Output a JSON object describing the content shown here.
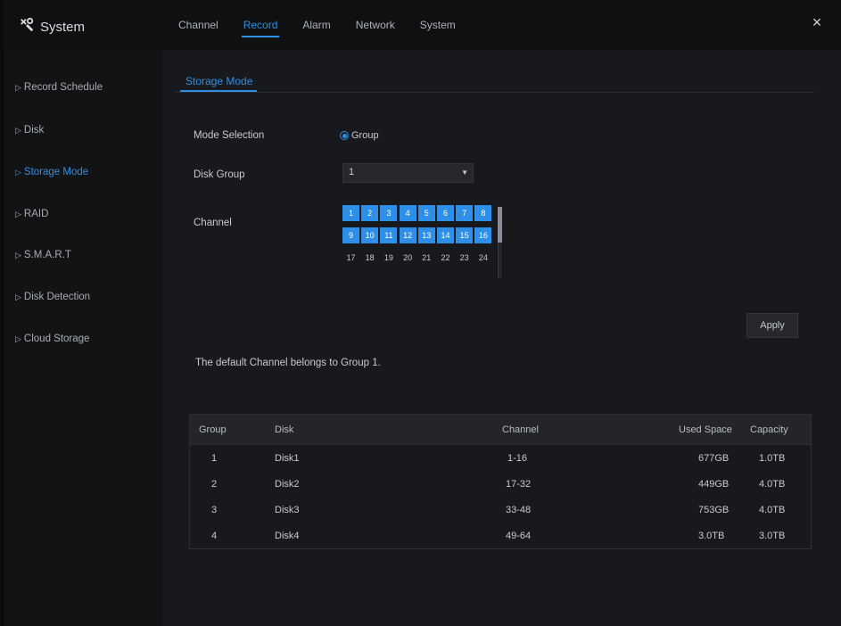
{
  "app": {
    "title": "System"
  },
  "tabs": [
    {
      "label": "Channel",
      "active": false
    },
    {
      "label": "Record",
      "active": true
    },
    {
      "label": "Alarm",
      "active": false
    },
    {
      "label": "Network",
      "active": false
    },
    {
      "label": "System",
      "active": false
    }
  ],
  "close_label": "×",
  "sidebar": {
    "items": [
      {
        "label": "Record Schedule",
        "active": false
      },
      {
        "label": "Disk",
        "active": false
      },
      {
        "label": "Storage Mode",
        "active": true
      },
      {
        "label": "RAID",
        "active": false
      },
      {
        "label": "S.M.A.R.T",
        "active": false
      },
      {
        "label": "Disk Detection",
        "active": false
      },
      {
        "label": "Cloud Storage",
        "active": false
      }
    ]
  },
  "subtab": {
    "label": "Storage Mode"
  },
  "form": {
    "mode_label": "Mode Selection",
    "mode_value": "Group",
    "disk_group_label": "Disk Group",
    "disk_group_value": "1",
    "channel_label": "Channel",
    "channels_selected": [
      "1",
      "2",
      "3",
      "4",
      "5",
      "6",
      "7",
      "8",
      "9",
      "10",
      "11",
      "12",
      "13",
      "14",
      "15",
      "16"
    ],
    "channels_unselected": [
      "17",
      "18",
      "19",
      "20",
      "21",
      "22",
      "23",
      "24"
    ],
    "apply_label": "Apply"
  },
  "note": "The default Channel belongs to Group 1.",
  "table": {
    "headers": [
      "Group",
      "Disk",
      "Channel",
      "Used Space",
      "Capacity"
    ],
    "rows": [
      [
        "1",
        "Disk1",
        "1-16",
        "677GB",
        "1.0TB"
      ],
      [
        "2",
        "Disk2",
        "17-32",
        "449GB",
        "4.0TB"
      ],
      [
        "3",
        "Disk3",
        "33-48",
        "753GB",
        "4.0TB"
      ],
      [
        "4",
        "Disk4",
        "49-64",
        "3.0TB",
        "3.0TB"
      ]
    ]
  },
  "colors": {
    "accent": "#2e8fe8",
    "background": "#18191c",
    "sidebar": "#121315"
  }
}
